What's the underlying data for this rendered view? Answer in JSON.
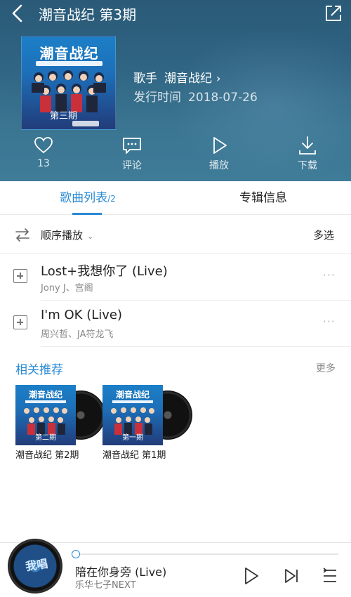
{
  "header": {
    "title": "潮音战纪 第3期",
    "cover": {
      "logo_text": "潮音战纪",
      "issue_text": "第三期"
    },
    "singer_label": "歌手",
    "singer_value": "潮音战纪",
    "release_label": "发行时间",
    "release_value": "2018-07-26",
    "actions": [
      {
        "icon": "heart-icon",
        "label": "13"
      },
      {
        "icon": "comment-icon",
        "label": "评论"
      },
      {
        "icon": "play-icon",
        "label": "播放"
      },
      {
        "icon": "download-icon",
        "label": "下载"
      }
    ]
  },
  "tabs": {
    "songs_label": "歌曲列表",
    "songs_count": "/2",
    "info_label": "专辑信息"
  },
  "toolbar": {
    "order_label": "顺序播放",
    "multi_select_label": "多选"
  },
  "songs": [
    {
      "title": "Lost+我想你了 (Live)",
      "artist": "Jony J、宫阁"
    },
    {
      "title": "I'm OK (Live)",
      "artist": "周兴哲、JA符龙飞"
    }
  ],
  "recommend": {
    "title": "相关推荐",
    "more_label": "更多",
    "albums": [
      {
        "name": "潮音战纪 第2期",
        "cover_issue": "第二期"
      },
      {
        "name": "潮音战纪 第1期",
        "cover_issue": "第一期"
      }
    ]
  },
  "player": {
    "title": "陪在你身旁 (Live)",
    "artist": "乐华七子NEXT",
    "art_text": "我唱",
    "progress": 0.0
  },
  "colors": {
    "accent": "#2a8ad4",
    "header_bg": "#2f6482"
  }
}
